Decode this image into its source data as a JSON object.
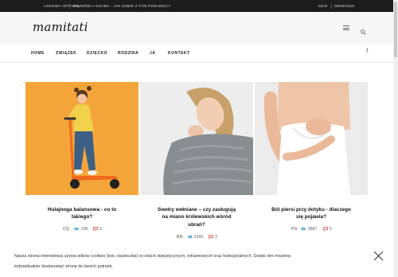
{
  "topbar": {
    "latest_label": "LOSOWY ARTYKUŁ",
    "latest_title": "ROZWÓD A OJCIEC - JAK SOBIE Z TYM PORADZIĆ?",
    "date_label": "DZIŚ",
    "date_value": "06/02/2026"
  },
  "header": {
    "logo": "mamitati",
    "menu_icon": "hamburger-icon",
    "search_icon": "search-icon"
  },
  "nav": {
    "items": [
      "HOME",
      "ZWIĄZEK",
      "DZIECKO",
      "RODZINA",
      "JA",
      "KONTAKT"
    ],
    "social_icon": "f"
  },
  "cards": [
    {
      "title_line1": "Hulajnoga balansowa - co to",
      "title_line2": "takiego?",
      "title_line3": "",
      "author": "CQ",
      "views": "135",
      "comments": "0",
      "image_bg": "#f3a23a"
    },
    {
      "title_line1": "Swetry wełniane – czy zasługują",
      "title_line2": "na miano królewskich wśród",
      "title_line3": "ubrań?",
      "author": "BN",
      "views": "2142",
      "comments": "3",
      "image_bg": "#ececec"
    },
    {
      "title_line1": "Ból piersi przy dotyku - dlaczego",
      "title_line2": "się pojawia?",
      "title_line3": "",
      "author": "PG",
      "views": "2687",
      "comments": "0",
      "image_bg": "#e9e9e9"
    }
  ],
  "cookie": {
    "line1": "Nasza strona internetowa używa plików cookies (tzw. ciasteczka) w celach statystycznych, reklamowych oraz funkcjonalnych. Dzięki nim możemy",
    "line2": "indywidualnie dostosować stronę do twoich potrzeb.",
    "close_icon": "close-icon"
  },
  "colors": {
    "accent": "#e03a3a",
    "views_icon": "#3aa0d8",
    "comments_icon": "#e03a3a",
    "topbar_bg": "#1c1c1c"
  }
}
